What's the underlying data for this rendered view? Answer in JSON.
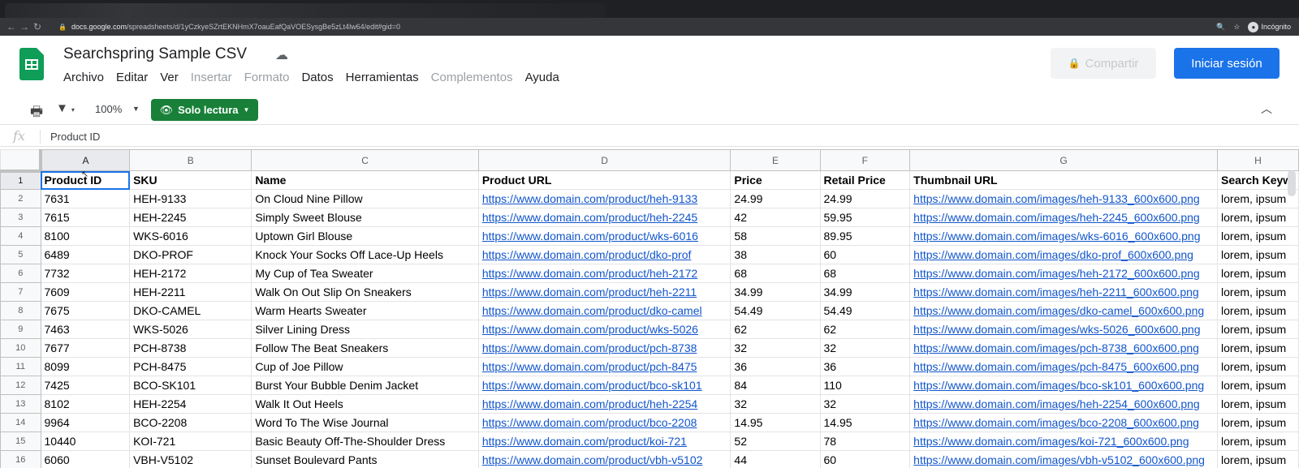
{
  "browser": {
    "url_host": "docs.google.com",
    "url_path": "/spreadsheets/d/1yCzkyeSZrtEKNHmX7oauEafQaVOESysgBe5zLt4lw64/edit#gid=0",
    "profile_label": "Incógnito"
  },
  "app": {
    "title": "Searchspring Sample CSV",
    "menu": [
      "Archivo",
      "Editar",
      "Ver",
      "Insertar",
      "Formato",
      "Datos",
      "Herramientas",
      "Complementos",
      "Ayuda"
    ],
    "menu_disabled": [
      false,
      false,
      false,
      true,
      true,
      false,
      false,
      true,
      false
    ],
    "share_label": "Compartir",
    "signin_label": "Iniciar sesión"
  },
  "toolbar": {
    "zoom": "100%",
    "readonly_label": "Solo lectura"
  },
  "formula_bar": {
    "fx": "fx",
    "value": "Product ID"
  },
  "sheet": {
    "columns": [
      "A",
      "B",
      "C",
      "D",
      "E",
      "F",
      "G",
      "H"
    ],
    "header": [
      "Product ID",
      "SKU",
      "Name",
      "Product URL",
      "Price",
      "Retail Price",
      "Thumbnail URL",
      "Search Keyw"
    ],
    "rows": [
      [
        "7631",
        "HEH-9133",
        "On Cloud Nine Pillow",
        "https://www.domain.com/product/heh-9133",
        "24.99",
        "24.99",
        "https://www.domain.com/images/heh-9133_600x600.png",
        "lorem, ipsum"
      ],
      [
        "7615",
        "HEH-2245",
        "Simply Sweet Blouse",
        "https://www.domain.com/product/heh-2245",
        "42",
        "59.95",
        "https://www.domain.com/images/heh-2245_600x600.png",
        "lorem, ipsum"
      ],
      [
        "8100",
        "WKS-6016",
        "Uptown Girl Blouse",
        "https://www.domain.com/product/wks-6016",
        "58",
        "89.95",
        "https://www.domain.com/images/wks-6016_600x600.png",
        "lorem, ipsum"
      ],
      [
        "6489",
        "DKO-PROF",
        "Knock Your Socks Off Lace-Up Heels",
        "https://www.domain.com/product/dko-prof",
        "38",
        "60",
        "https://www.domain.com/images/dko-prof_600x600.png",
        "lorem, ipsum"
      ],
      [
        "7732",
        "HEH-2172",
        "My Cup of Tea Sweater",
        "https://www.domain.com/product/heh-2172",
        "68",
        "68",
        "https://www.domain.com/images/heh-2172_600x600.png",
        "lorem, ipsum"
      ],
      [
        "7609",
        "HEH-2211",
        "Walk On Out Slip On Sneakers",
        "https://www.domain.com/product/heh-2211",
        "34.99",
        "34.99",
        "https://www.domain.com/images/heh-2211_600x600.png",
        "lorem, ipsum"
      ],
      [
        "7675",
        "DKO-CAMEL",
        "Warm Hearts Sweater",
        "https://www.domain.com/product/dko-camel",
        "54.49",
        "54.49",
        "https://www.domain.com/images/dko-camel_600x600.png",
        "lorem, ipsum"
      ],
      [
        "7463",
        "WKS-5026",
        "Silver Lining Dress",
        "https://www.domain.com/product/wks-5026",
        "62",
        "62",
        "https://www.domain.com/images/wks-5026_600x600.png",
        "lorem, ipsum"
      ],
      [
        "7677",
        "PCH-8738",
        "Follow The Beat Sneakers",
        "https://www.domain.com/product/pch-8738",
        "32",
        "32",
        "https://www.domain.com/images/pch-8738_600x600.png",
        "lorem, ipsum"
      ],
      [
        "8099",
        "PCH-8475",
        "Cup of Joe Pillow",
        "https://www.domain.com/product/pch-8475",
        "36",
        "36",
        "https://www.domain.com/images/pch-8475_600x600.png",
        "lorem, ipsum"
      ],
      [
        "7425",
        "BCO-SK101",
        "Burst Your Bubble Denim Jacket",
        "https://www.domain.com/product/bco-sk101",
        "84",
        "110",
        "https://www.domain.com/images/bco-sk101_600x600.png",
        "lorem, ipsum"
      ],
      [
        "8102",
        "HEH-2254",
        "Walk It Out Heels",
        "https://www.domain.com/product/heh-2254",
        "32",
        "32",
        "https://www.domain.com/images/heh-2254_600x600.png",
        "lorem, ipsum"
      ],
      [
        "9964",
        "BCO-2208",
        "Word To The Wise Journal",
        "https://www.domain.com/product/bco-2208",
        "14.95",
        "14.95",
        "https://www.domain.com/images/bco-2208_600x600.png",
        "lorem, ipsum"
      ],
      [
        "10440",
        "KOI-721",
        "Basic Beauty Off-The-Shoulder Dress",
        "https://www.domain.com/product/koi-721",
        "52",
        "78",
        "https://www.domain.com/images/koi-721_600x600.png",
        "lorem, ipsum"
      ],
      [
        "6060",
        "VBH-V5102",
        "Sunset Boulevard Pants",
        "https://www.domain.com/product/vbh-v5102",
        "44",
        "60",
        "https://www.domain.com/images/vbh-v5102_600x600.png",
        "lorem, ipsum"
      ]
    ],
    "link_columns": [
      3,
      6
    ]
  },
  "colors": {
    "accent": "#1a73e8",
    "readonly_green": "#188038",
    "link": "#1155cc",
    "logo_green": "#0f9d58"
  },
  "icons": [
    "back-icon",
    "forward-icon",
    "reload-icon",
    "lock-icon",
    "zoom-icon",
    "star-icon",
    "incognito-icon",
    "sheets-logo-icon",
    "cloud-icon",
    "print-icon",
    "filter-icon",
    "eye-icon",
    "collapse-icon",
    "fx-icon"
  ]
}
